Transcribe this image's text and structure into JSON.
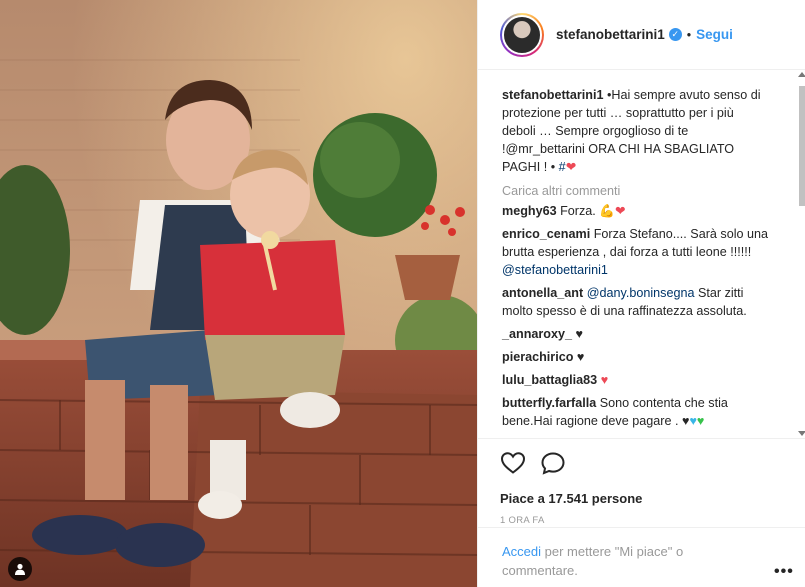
{
  "post": {
    "username": "stefanobettarini1",
    "follow_label": "Segui",
    "dot": "•",
    "caption_user": "stefanobettarini1",
    "caption_text": "•Hai sempre avuto senso di protezione per tutti … soprattutto per i più deboli … Sempre orgoglioso di te !@mr_bettarini ORA CHI HA SBAGLIATO PAGHI ! •",
    "caption_hashtag": "#",
    "load_more": "Carica altri commenti"
  },
  "comments": [
    {
      "user": "meghy63",
      "text": "Forza.",
      "emoji": "💪❤"
    },
    {
      "user": "enrico_cenami",
      "text": "Forza Stefano.... Sarà solo una brutta esperienza , dai forza a tutti leone !!!!!!",
      "mention": "@stefanobettarini1"
    },
    {
      "user": "antonella_ant",
      "mention": "@dany.boninsegna",
      "text": "Star zitti molto spesso è di una raffinatezza assoluta."
    },
    {
      "user": "_annaroxy_",
      "emoji": "♥"
    },
    {
      "user": "pierachirico",
      "emoji": "♥"
    },
    {
      "user": "lulu_battaglia83",
      "emoji": "♥"
    },
    {
      "user": "butterfly.farfalla",
      "text": "Sono contenta che stia bene.Hai ragione deve pagare ."
    }
  ],
  "actions": {
    "likes": "Piace a 17.541 persone",
    "time": "1 ORA FA"
  },
  "login": {
    "link": "Accedi",
    "text": "per mettere \"Mi piace\" o commentare.",
    "more": "•••"
  },
  "icons": {
    "verified": "verified-badge-icon",
    "like": "heart-outline-icon",
    "comment": "speech-bubble-icon",
    "tag": "user-tag-icon"
  },
  "colors": {
    "link": "#3897f0",
    "heart": "#ed4956",
    "text": "#262626",
    "muted": "#999999"
  }
}
